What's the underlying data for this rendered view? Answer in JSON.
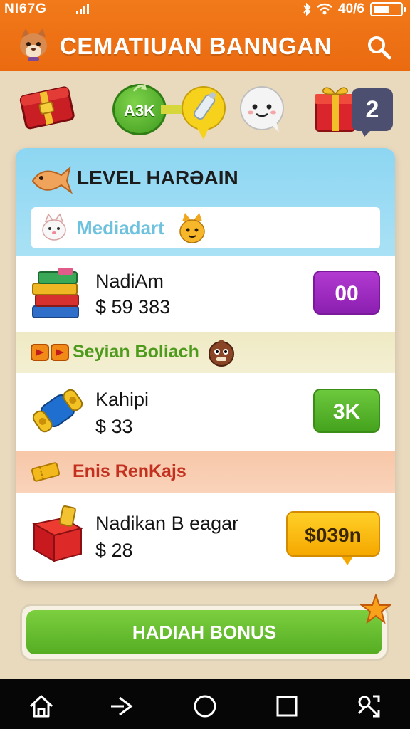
{
  "status_bar": {
    "carrier": "NI67G",
    "network": "40/6"
  },
  "header": {
    "title": "CEMATIUAN BANNGAN"
  },
  "icon_row": {
    "green_pill_text": "A3K",
    "badge_count": "2"
  },
  "card": {
    "level_title": "LEVEL HARƏAIN",
    "sub_label": "Mediadart",
    "items": [
      {
        "name": "NadiAm",
        "price": "$ 59 383",
        "button": "00"
      },
      {
        "name": "Kahipi",
        "price": "$ 33",
        "button": "3K"
      },
      {
        "name": "Nadikan B eagar",
        "price": "$ 28",
        "button": "$039n"
      }
    ],
    "section2_label": "Seyian Boliach",
    "section3_label": "Enis RenKajs"
  },
  "bonus_button": {
    "label": "HADIAH BONUS"
  },
  "colors": {
    "header": "#ea6a10",
    "accent_blue": "#8dd6f2",
    "accent_green": "#55ad22",
    "accent_purple": "#8b1fb0",
    "accent_yellow": "#f5a800"
  }
}
